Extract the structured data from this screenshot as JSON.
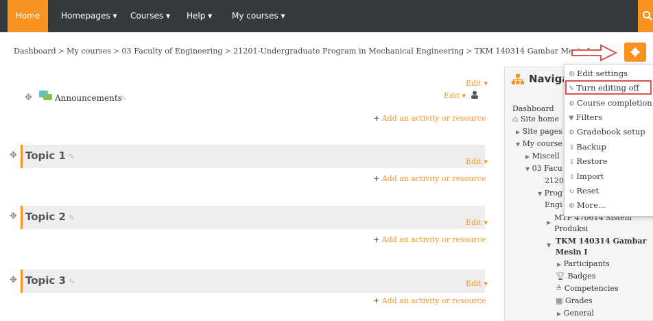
{
  "navbar": {
    "home": "Home",
    "items": [
      "Homepages ▾",
      "Courses ▾",
      "Help ▾",
      "My courses ▾"
    ]
  },
  "breadcrumb": [
    "Dashboard",
    "My courses",
    "03 Faculty of Engineering",
    "21201-Undergraduate Program in Mechanical Engineering",
    "TKM 140314 Gambar Mesin I"
  ],
  "breadcrumb_sep": ">",
  "colors": {
    "accent": "#f7931e",
    "navbar": "#373a3c",
    "highlight": "#d9534f"
  },
  "sections": {
    "announcements": "Announcements",
    "edit": "Edit ▾",
    "edit_user": "Edit ▾",
    "add": "Add an activity or resource",
    "topics": [
      "Topic 1",
      "Topic 2",
      "Topic 3"
    ]
  },
  "navigation": {
    "title": "Naviga",
    "items": {
      "dashboard": "Dashboard",
      "site_home": "Site home",
      "site_pages": "Site pages",
      "my_courses": "My course",
      "miscell": "Miscell",
      "faculty": "03 Facu",
      "code": "21201",
      "prog": "Prog",
      "engi": "Engi",
      "mtp": "MTP 470614 Sistem",
      "produksi": "Produksi",
      "tkm1": "TKM 140314 Gambar",
      "tkm2": "Mesin I",
      "participants": "Participants",
      "badges": "Badges",
      "competencies": "Competencies",
      "grades": "Grades",
      "general": "General"
    }
  },
  "dropdown": [
    {
      "icon": "gear-icon",
      "label": "Edit settings"
    },
    {
      "icon": "pencil-icon",
      "label": "Turn editing off"
    },
    {
      "icon": "gear-icon",
      "label": "Course completion"
    },
    {
      "icon": "filter-icon",
      "label": "Filters"
    },
    {
      "icon": "gear-icon",
      "label": "Gradebook setup"
    },
    {
      "icon": "upload-icon",
      "label": "Backup"
    },
    {
      "icon": "upload-icon",
      "label": "Restore"
    },
    {
      "icon": "upload-icon",
      "label": "Import"
    },
    {
      "icon": "refresh-icon",
      "label": "Reset"
    },
    {
      "icon": "gear-icon",
      "label": "More..."
    }
  ]
}
